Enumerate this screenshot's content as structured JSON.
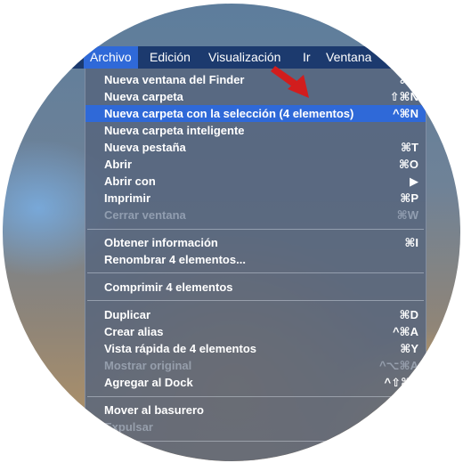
{
  "menubar": {
    "items": [
      {
        "label": "Archivo"
      },
      {
        "label": "Edición"
      },
      {
        "label": "Visualización"
      },
      {
        "label": "Ir"
      },
      {
        "label": "Ventana"
      }
    ]
  },
  "dropdown": {
    "items": [
      {
        "label": "Nueva ventana del Finder",
        "shortcut": "⌘N"
      },
      {
        "label": "Nueva carpeta",
        "shortcut": "⇧⌘N"
      },
      {
        "label": "Nueva carpeta con la selección (4 elementos)",
        "shortcut": "^⌘N"
      },
      {
        "label": "Nueva carpeta inteligente",
        "shortcut": ""
      },
      {
        "label": "Nueva pestaña",
        "shortcut": "⌘T"
      },
      {
        "label": "Abrir",
        "shortcut": "⌘O"
      },
      {
        "label": "Abrir con",
        "shortcut": "▶"
      },
      {
        "label": "Imprimir",
        "shortcut": "⌘P"
      },
      {
        "label": "Cerrar ventana",
        "shortcut": "⌘W"
      },
      {
        "label": "Obtener información",
        "shortcut": "⌘I"
      },
      {
        "label": "Renombrar 4 elementos...",
        "shortcut": ""
      },
      {
        "label": "Comprimir 4 elementos",
        "shortcut": ""
      },
      {
        "label": "Duplicar",
        "shortcut": "⌘D"
      },
      {
        "label": "Crear alias",
        "shortcut": "^⌘A"
      },
      {
        "label": "Vista rápida de 4 elementos",
        "shortcut": "⌘Y"
      },
      {
        "label": "Mostrar original",
        "shortcut": "^⌥⌘A"
      },
      {
        "label": "Agregar al Dock",
        "shortcut": "^⇧⌘T"
      },
      {
        "label": "Mover al basurero",
        "shortcut": ""
      },
      {
        "label": "Expulsar",
        "shortcut": ""
      }
    ]
  },
  "colors": {
    "menubar": "#1c3a6e",
    "highlight": "#2f69d8",
    "arrow": "#d21d1d"
  }
}
